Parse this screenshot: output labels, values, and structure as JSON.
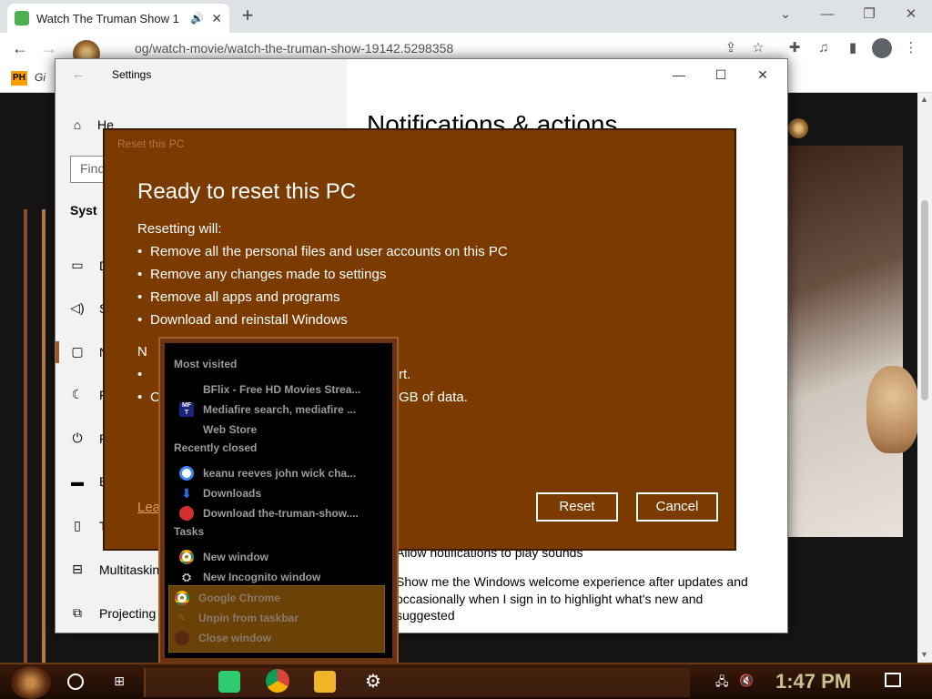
{
  "browser": {
    "tab_title": "Watch The Truman Show 1",
    "url": "og/watch-movie/watch-the-truman-show-19142.5298358",
    "bookmark_badge": "PH",
    "bookmark_text": "Gi"
  },
  "settings": {
    "title": "Settings",
    "home_label": "He",
    "find_placeholder": "Find",
    "system_label": "Syst",
    "sidebar": [
      {
        "label": "D"
      },
      {
        "label": "S"
      },
      {
        "label": "N"
      },
      {
        "label": "F"
      },
      {
        "label": "P"
      },
      {
        "label": "B"
      },
      {
        "label": "T"
      },
      {
        "label": "Multitasking"
      },
      {
        "label": "Projecting"
      }
    ],
    "main_title": "Notifications & actions",
    "options": [
      "Allow notifications to play sounds",
      "Show me the Windows welcome experience after updates and",
      "occasionally when I sign in to highlight what's new and",
      "suggested"
    ]
  },
  "dialog": {
    "caption": "Reset this PC",
    "heading": "Ready to reset this PC",
    "subheading": "Resetting will:",
    "bullets": [
      "Remove all the personal files and user accounts on this PC",
      "Remove any changes made to settings",
      "Remove all apps and programs",
      "Download and reinstall Windows"
    ],
    "partial_1": "N",
    "partial_2": "rt.",
    "partial_3": "C",
    "partial_4": "GB of data.",
    "learn_more": "Lea",
    "reset_label": "Reset",
    "cancel_label": "Cancel"
  },
  "jumplist": {
    "most_visited_header": "Most visited",
    "most_visited": [
      {
        "label": "BFlix - Free HD Movies Strea...",
        "icon": "blank-icon"
      },
      {
        "label": "Mediafire search, mediafire ...",
        "icon": "mediafire-icon"
      },
      {
        "label": "Web Store",
        "icon": "blank-icon"
      }
    ],
    "recently_closed_header": "Recently closed",
    "recently_closed": [
      {
        "label": "keanu reeves john wick cha...",
        "icon": "google-icon"
      },
      {
        "label": "Downloads",
        "icon": "download-icon"
      },
      {
        "label": "Download the-truman-show....",
        "icon": "mask-icon"
      }
    ],
    "tasks_header": "Tasks",
    "tasks": [
      {
        "label": "New window",
        "icon": "chrome-icon"
      },
      {
        "label": "New Incognito window",
        "icon": "incognito-icon"
      }
    ],
    "app_actions": [
      {
        "label": "Google Chrome",
        "icon": "chrome-icon"
      },
      {
        "label": "Unpin from taskbar",
        "icon": "unpin-icon"
      },
      {
        "label": "Close window",
        "icon": "close-icon"
      }
    ]
  },
  "taskbar": {
    "clock": "1:47 PM"
  },
  "colors": {
    "dialog_bg": "#7a3a00",
    "jump_bg": "#000000",
    "accent": "#a0561c"
  }
}
